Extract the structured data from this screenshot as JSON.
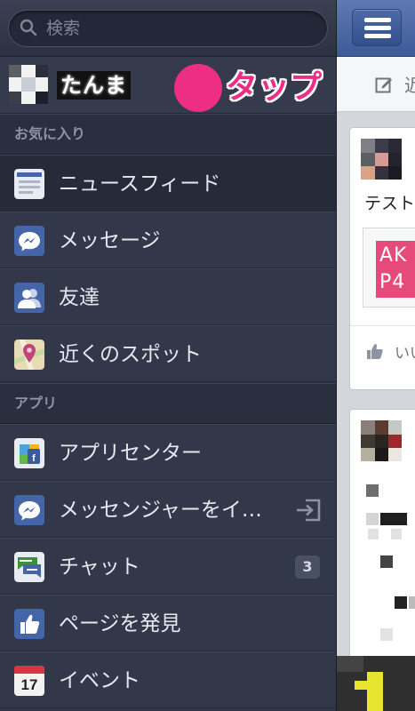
{
  "search": {
    "placeholder": "検索"
  },
  "profile": {
    "name": "たんま"
  },
  "annotation": {
    "label": "タップ",
    "color": "#ee2d85"
  },
  "sections": {
    "favorites": "お気に入り",
    "apps": "アプリ"
  },
  "favorites": [
    {
      "label": "ニュースフィード",
      "icon": "news-feed-icon",
      "selected": true
    },
    {
      "label": "メッセージ",
      "icon": "messages-icon"
    },
    {
      "label": "友達",
      "icon": "friends-icon"
    },
    {
      "label": "近くのスポット",
      "icon": "nearby-places-icon"
    }
  ],
  "apps": [
    {
      "label": "アプリセンター",
      "icon": "app-center-icon"
    },
    {
      "label": "メッセンジャーをイ…",
      "icon": "messenger-icon",
      "trailing": "exit-icon"
    },
    {
      "label": "チャット",
      "icon": "chat-icon",
      "badge": "3"
    },
    {
      "label": "ページを発見",
      "icon": "like-icon"
    },
    {
      "label": "イベント",
      "icon": "calendar-icon",
      "icon_text": "17"
    }
  ],
  "feed": {
    "status_label": "近",
    "post_text": "テスト",
    "link_thumb_text": "AK\nP4",
    "like_label": "いい"
  },
  "colors": {
    "drawer_bg": "#2f3547",
    "facebook_blue": "#3d5a98",
    "text": "#e6e8ee",
    "section_text": "#8d93a3"
  }
}
